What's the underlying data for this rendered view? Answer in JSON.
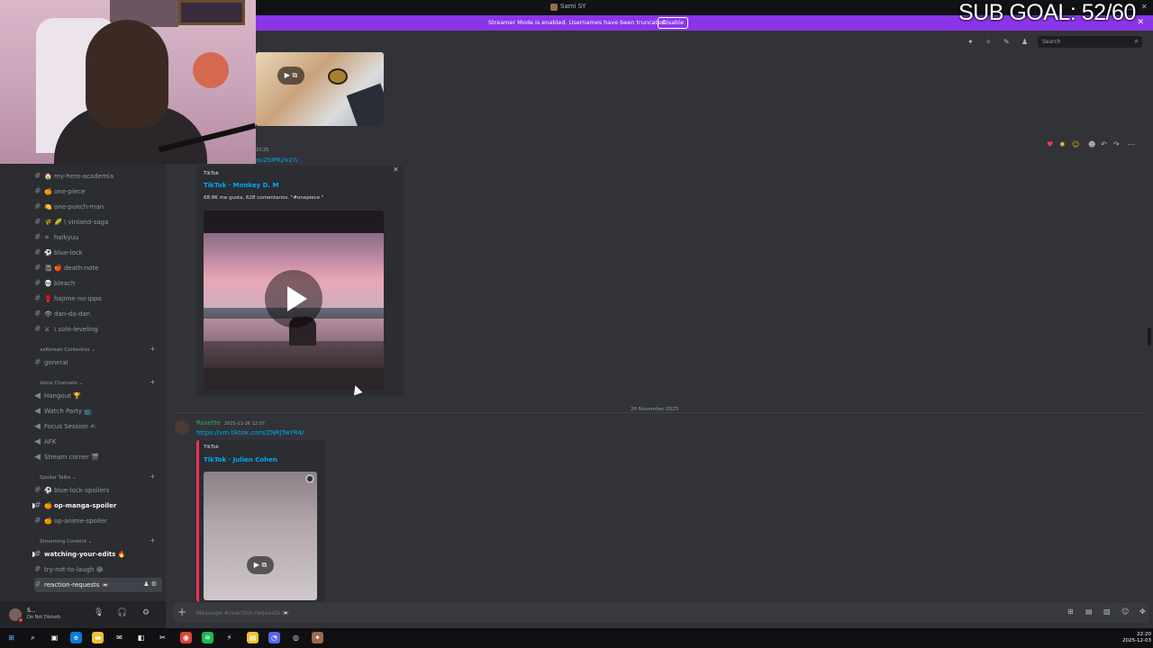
{
  "window": {
    "title": "Sami SY",
    "minimize": "—",
    "maximize": "▢",
    "close": "✕"
  },
  "banner": {
    "message": "Streamer Mode is enabled. Usernames have been truncated.",
    "button": "Disable",
    "close": "✕"
  },
  "overlay": {
    "sub_goal": "SUB GOAL: 52/60"
  },
  "sidebar": {
    "channels": [
      {
        "glyph": "🏠",
        "label": "my-hero-academia"
      },
      {
        "glyph": "🍊",
        "label": "one-piece"
      },
      {
        "glyph": "🍋",
        "label": "one-punch-man"
      },
      {
        "glyph": "🌾",
        "label": "🌽 \\ vinland-saga"
      },
      {
        "glyph": "⚪",
        "label": "haikyuu"
      },
      {
        "glyph": "⚽",
        "label": "blue-lock"
      },
      {
        "glyph": "📓",
        "label": "🍎 death-note"
      },
      {
        "glyph": "💀",
        "label": "bleach"
      },
      {
        "glyph": "🥊",
        "label": "hajime-no-ippo"
      },
      {
        "glyph": "👁",
        "label": "dan-da-dan"
      },
      {
        "glyph": "⚔",
        "label": "\\ solo-leveling"
      }
    ],
    "cat_korean": "xxKorean Contentxx ⌄",
    "general": "general",
    "cat_voice": "Voice Channels ⌄",
    "voice": [
      {
        "label": "Hangout 🏆"
      },
      {
        "label": "Watch Party 📺"
      },
      {
        "label": "Focus Session ✍"
      },
      {
        "label": "AFK"
      },
      {
        "label": "Stream corner 🎬"
      }
    ],
    "cat_spoiler": "Spoiler Talks ⌄",
    "spoilers": [
      {
        "glyph": "⚽",
        "label": "blue-lock-spoilers"
      },
      {
        "glyph": "🍊",
        "label": "op-manga-spoiler"
      },
      {
        "glyph": "🍊",
        "label": "op-anime-spoiler"
      }
    ],
    "cat_streaming": "Streaming Content ⌄",
    "streaming": [
      {
        "label": "watching-your-edits 🔥"
      },
      {
        "label": "try-not-to-laugh 😂"
      },
      {
        "label": "reaction-requests 📼"
      }
    ],
    "plus": "+"
  },
  "user": {
    "name": "S...",
    "status": "Do Not Disturb"
  },
  "header": {
    "search_placeholder": "Search"
  },
  "messages": {
    "partial_time": "10:25",
    "partial_link": "m/ZSfPR2V27/",
    "embed1": {
      "provider": "TikTok",
      "title": "TikTok · Monkey D. M",
      "description": "68.8K me gusta, 628 comentarios. \"#onepiece \""
    },
    "divider": "26 November 2025",
    "msg2": {
      "author": "Roxette",
      "timestamp": "2025-11-26 12:57",
      "link": "https://vm.tiktok.com/ZNRJTwYR4/",
      "embed_provider": "TikTok",
      "embed_title": "TikTok · Julien Cohen"
    }
  },
  "composer": {
    "placeholder": "Message #reaction-requests 📼"
  },
  "taskbar": {
    "time": "22:20",
    "date": "2025-12-03"
  }
}
